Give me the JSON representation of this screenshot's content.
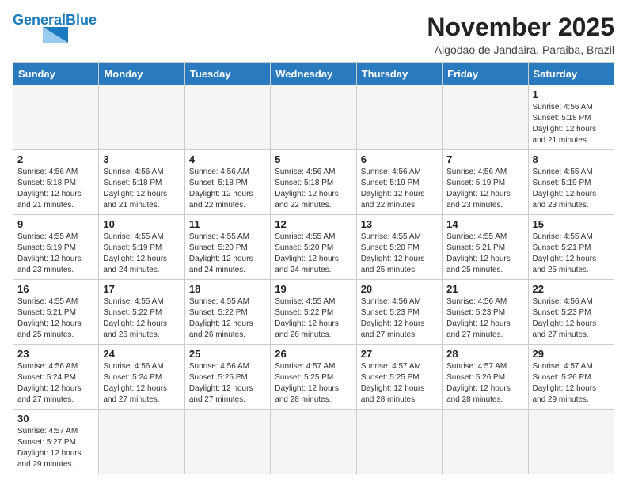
{
  "header": {
    "logo_general": "General",
    "logo_blue": "Blue",
    "title": "November 2025",
    "subtitle": "Algodao de Jandaira, Paraiba, Brazil"
  },
  "weekdays": [
    "Sunday",
    "Monday",
    "Tuesday",
    "Wednesday",
    "Thursday",
    "Friday",
    "Saturday"
  ],
  "weeks": [
    [
      {
        "day": "",
        "info": ""
      },
      {
        "day": "",
        "info": ""
      },
      {
        "day": "",
        "info": ""
      },
      {
        "day": "",
        "info": ""
      },
      {
        "day": "",
        "info": ""
      },
      {
        "day": "",
        "info": ""
      },
      {
        "day": "1",
        "info": "Sunrise: 4:56 AM\nSunset: 5:18 PM\nDaylight: 12 hours and 21 minutes."
      }
    ],
    [
      {
        "day": "2",
        "info": "Sunrise: 4:56 AM\nSunset: 5:18 PM\nDaylight: 12 hours and 21 minutes."
      },
      {
        "day": "3",
        "info": "Sunrise: 4:56 AM\nSunset: 5:18 PM\nDaylight: 12 hours and 21 minutes."
      },
      {
        "day": "4",
        "info": "Sunrise: 4:56 AM\nSunset: 5:18 PM\nDaylight: 12 hours and 22 minutes."
      },
      {
        "day": "5",
        "info": "Sunrise: 4:56 AM\nSunset: 5:18 PM\nDaylight: 12 hours and 22 minutes."
      },
      {
        "day": "6",
        "info": "Sunrise: 4:56 AM\nSunset: 5:19 PM\nDaylight: 12 hours and 22 minutes."
      },
      {
        "day": "7",
        "info": "Sunrise: 4:56 AM\nSunset: 5:19 PM\nDaylight: 12 hours and 23 minutes."
      },
      {
        "day": "8",
        "info": "Sunrise: 4:55 AM\nSunset: 5:19 PM\nDaylight: 12 hours and 23 minutes."
      }
    ],
    [
      {
        "day": "9",
        "info": "Sunrise: 4:55 AM\nSunset: 5:19 PM\nDaylight: 12 hours and 23 minutes."
      },
      {
        "day": "10",
        "info": "Sunrise: 4:55 AM\nSunset: 5:19 PM\nDaylight: 12 hours and 24 minutes."
      },
      {
        "day": "11",
        "info": "Sunrise: 4:55 AM\nSunset: 5:20 PM\nDaylight: 12 hours and 24 minutes."
      },
      {
        "day": "12",
        "info": "Sunrise: 4:55 AM\nSunset: 5:20 PM\nDaylight: 12 hours and 24 minutes."
      },
      {
        "day": "13",
        "info": "Sunrise: 4:55 AM\nSunset: 5:20 PM\nDaylight: 12 hours and 25 minutes."
      },
      {
        "day": "14",
        "info": "Sunrise: 4:55 AM\nSunset: 5:21 PM\nDaylight: 12 hours and 25 minutes."
      },
      {
        "day": "15",
        "info": "Sunrise: 4:55 AM\nSunset: 5:21 PM\nDaylight: 12 hours and 25 minutes."
      }
    ],
    [
      {
        "day": "16",
        "info": "Sunrise: 4:55 AM\nSunset: 5:21 PM\nDaylight: 12 hours and 25 minutes."
      },
      {
        "day": "17",
        "info": "Sunrise: 4:55 AM\nSunset: 5:22 PM\nDaylight: 12 hours and 26 minutes."
      },
      {
        "day": "18",
        "info": "Sunrise: 4:55 AM\nSunset: 5:22 PM\nDaylight: 12 hours and 26 minutes."
      },
      {
        "day": "19",
        "info": "Sunrise: 4:55 AM\nSunset: 5:22 PM\nDaylight: 12 hours and 26 minutes."
      },
      {
        "day": "20",
        "info": "Sunrise: 4:56 AM\nSunset: 5:23 PM\nDaylight: 12 hours and 27 minutes."
      },
      {
        "day": "21",
        "info": "Sunrise: 4:56 AM\nSunset: 5:23 PM\nDaylight: 12 hours and 27 minutes."
      },
      {
        "day": "22",
        "info": "Sunrise: 4:56 AM\nSunset: 5:23 PM\nDaylight: 12 hours and 27 minutes."
      }
    ],
    [
      {
        "day": "23",
        "info": "Sunrise: 4:56 AM\nSunset: 5:24 PM\nDaylight: 12 hours and 27 minutes."
      },
      {
        "day": "24",
        "info": "Sunrise: 4:56 AM\nSunset: 5:24 PM\nDaylight: 12 hours and 27 minutes."
      },
      {
        "day": "25",
        "info": "Sunrise: 4:56 AM\nSunset: 5:25 PM\nDaylight: 12 hours and 27 minutes."
      },
      {
        "day": "26",
        "info": "Sunrise: 4:57 AM\nSunset: 5:25 PM\nDaylight: 12 hours and 28 minutes."
      },
      {
        "day": "27",
        "info": "Sunrise: 4:57 AM\nSunset: 5:25 PM\nDaylight: 12 hours and 28 minutes."
      },
      {
        "day": "28",
        "info": "Sunrise: 4:57 AM\nSunset: 5:26 PM\nDaylight: 12 hours and 28 minutes."
      },
      {
        "day": "29",
        "info": "Sunrise: 4:57 AM\nSunset: 5:26 PM\nDaylight: 12 hours and 29 minutes."
      }
    ],
    [
      {
        "day": "30",
        "info": "Sunrise: 4:57 AM\nSunset: 5:27 PM\nDaylight: 12 hours and 29 minutes."
      },
      {
        "day": "",
        "info": ""
      },
      {
        "day": "",
        "info": ""
      },
      {
        "day": "",
        "info": ""
      },
      {
        "day": "",
        "info": ""
      },
      {
        "day": "",
        "info": ""
      },
      {
        "day": "",
        "info": ""
      }
    ]
  ]
}
